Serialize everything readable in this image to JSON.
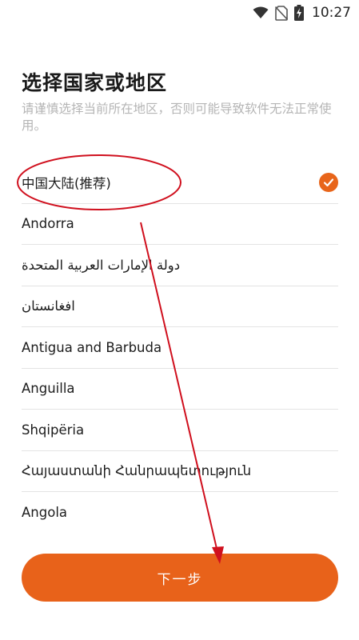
{
  "status_bar": {
    "time": "10:27",
    "icons": [
      "wifi-icon",
      "no-sim-icon",
      "battery-charging-icon"
    ]
  },
  "page": {
    "title": "选择国家或地区",
    "subtitle": "请谨慎选择当前所在地区，否则可能导致软件无法正常使用。"
  },
  "regions": [
    {
      "label": "中国大陆(推荐)",
      "selected": true
    },
    {
      "label": "Andorra",
      "selected": false
    },
    {
      "label": "دولة الإمارات العربية المتحدة",
      "selected": false
    },
    {
      "label": "افغانستان",
      "selected": false
    },
    {
      "label": "Antigua and Barbuda",
      "selected": false
    },
    {
      "label": "Anguilla",
      "selected": false
    },
    {
      "label": "Shqipëria",
      "selected": false
    },
    {
      "label": "Հայաստանի Հանրապետություն",
      "selected": false
    },
    {
      "label": "Angola",
      "selected": false
    }
  ],
  "next_button": {
    "label": "下一步"
  },
  "colors": {
    "accent": "#e8621a",
    "annotation": "#d0101e",
    "subtitle": "#b5b5b5",
    "divider": "#e3e3e3"
  }
}
